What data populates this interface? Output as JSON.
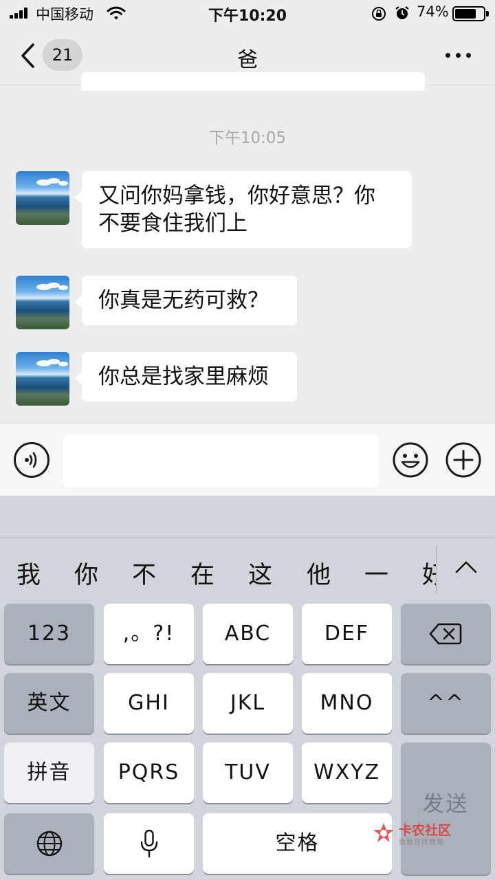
{
  "status_bar": {
    "carrier": "中国移动",
    "time": "下午10:20",
    "battery_percent": "74%",
    "battery_level": 0.74,
    "icons": [
      "signal-icon",
      "wifi-icon",
      "rotation-lock-icon",
      "alarm-icon",
      "battery-icon"
    ]
  },
  "nav": {
    "back_icon": "chevron-left-icon",
    "unread_count": "21",
    "title": "爸",
    "more_icon": "ellipsis-icon"
  },
  "chat": {
    "timestamp": "下午10:05",
    "messages": [
      {
        "sender": "other",
        "text_line1": "又问你妈拿钱，你好意思？你",
        "text_line2": "不要食住我们上"
      },
      {
        "sender": "other",
        "text": "你真是无药可救？"
      },
      {
        "sender": "other",
        "text": "你总是找家里麻烦"
      }
    ]
  },
  "input_bar": {
    "voice_icon": "voice-icon",
    "input_value": "",
    "emoji_icon": "emoji-icon",
    "plus_icon": "plus-icon"
  },
  "keyboard": {
    "candidates": [
      "我",
      "你",
      "不",
      "在",
      "这",
      "他",
      "一",
      "好"
    ],
    "collapse_icon": "chevron-up-icon",
    "rows": [
      [
        "123",
        ",。?!",
        "ABC",
        "DEF",
        "⌫"
      ],
      [
        "英文",
        "GHI",
        "JKL",
        "MNO",
        "^^"
      ],
      [
        "拼音",
        "PQRS",
        "TUV",
        "WXYZ"
      ],
      [
        "🌐",
        "🎤",
        "空格"
      ]
    ],
    "send_label": "发送",
    "watermark_title": "卡农社区",
    "watermark_subtitle": "金融在线教育"
  },
  "colors": {
    "chat_background": "#ededed",
    "bubble": "#ffffff",
    "keyboard_background": "#d1d4da",
    "function_key": "#abb1bb",
    "watermark": "#d84a4a"
  }
}
